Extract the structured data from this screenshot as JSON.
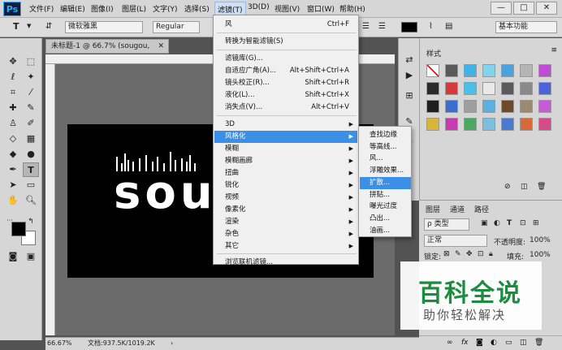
{
  "menubar": {
    "logo": "Ps",
    "items": [
      "文件(F)",
      "编辑(E)",
      "图像(I)",
      "图层(L)",
      "文字(Y)",
      "选择(S)",
      "滤镜(T)",
      "3D(D)",
      "视图(V)",
      "窗口(W)",
      "帮助(H)"
    ],
    "active_index": 6,
    "window_buttons": [
      "—",
      "□",
      "✕"
    ]
  },
  "options": {
    "tool_glyph": "T",
    "font_family": "微软雅黑",
    "font_style": "Regular",
    "workspace": "基本功能"
  },
  "document": {
    "tab_title": "未标题-1 @ 66.7% (sougou, RGB/8) *",
    "tab_close": "✕",
    "canvas_text": "sou",
    "zoom": "66.67%",
    "doc_info": "文档:937.5K/1019.2K"
  },
  "filter_menu": {
    "items": [
      {
        "label": "风",
        "shortcut": "Ctrl+F"
      },
      {
        "label": "转换为智能滤镜(S)",
        "shortcut": ""
      },
      {
        "label": "滤镜库(G)...",
        "shortcut": ""
      },
      {
        "label": "自适应广角(A)...",
        "shortcut": "Alt+Shift+Ctrl+A"
      },
      {
        "label": "镜头校正(R)...",
        "shortcut": "Shift+Ctrl+R"
      },
      {
        "label": "液化(L)...",
        "shortcut": "Shift+Ctrl+X"
      },
      {
        "label": "消失点(V)...",
        "shortcut": "Alt+Ctrl+V"
      },
      {
        "label": "3D",
        "shortcut": ""
      },
      {
        "label": "风格化",
        "shortcut": ""
      },
      {
        "label": "模糊",
        "shortcut": ""
      },
      {
        "label": "模糊画廊",
        "shortcut": ""
      },
      {
        "label": "扭曲",
        "shortcut": ""
      },
      {
        "label": "锐化",
        "shortcut": ""
      },
      {
        "label": "视频",
        "shortcut": ""
      },
      {
        "label": "像素化",
        "shortcut": ""
      },
      {
        "label": "渲染",
        "shortcut": ""
      },
      {
        "label": "杂色",
        "shortcut": ""
      },
      {
        "label": "其它",
        "shortcut": ""
      },
      {
        "label": "浏览联机滤镜...",
        "shortcut": ""
      }
    ],
    "highlighted_index": 8
  },
  "stylize_submenu": {
    "items": [
      "查找边缘",
      "等高线...",
      "风...",
      "浮雕效果...",
      "扩散...",
      "拼贴...",
      "曝光过度",
      "凸出...",
      "油画..."
    ],
    "highlighted_index": 4
  },
  "styles_panel": {
    "title": "样式",
    "swatch_colors": [
      "#ffffff",
      "#5a5a5a",
      "#3fb3e6",
      "#7fd4f0",
      "#4aa3df",
      "#b5b5b5",
      "#c24bd6",
      "#2a2a2a",
      "#d43a3a",
      "#4ac0e8",
      "#e9e9e9",
      "#5a5a5a",
      "#8a8a8a",
      "#4b62d8",
      "#1f1f1f",
      "#3a6fd0",
      "#9e9e9e",
      "#5ab0e0",
      "#6c4a2a",
      "#9b8a70",
      "#c65bd4",
      "#d8b43a",
      "#c83ab0",
      "#4aa860",
      "#7bbfe0",
      "#4a7ad0",
      "#d86a3a",
      "#d84a8a"
    ]
  },
  "layers_panel": {
    "tabs": [
      "图层",
      "通道",
      "路径"
    ],
    "filter_kind": "类型",
    "blend_mode": "正常",
    "opacity_label": "不透明度:",
    "opacity_value": "100%",
    "lock_label": "锁定:",
    "fill_label": "填充:",
    "fill_value": "100%"
  },
  "watermark": {
    "logo": "百科全说",
    "sub": "助你轻松解决"
  }
}
